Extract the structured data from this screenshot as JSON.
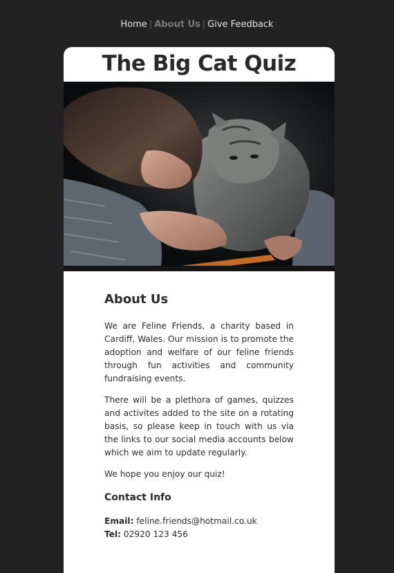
{
  "nav": {
    "items": [
      "Home",
      "About Us",
      "Give Feedback"
    ],
    "separator": "|",
    "active": "About Us"
  },
  "header": {
    "title": "The Big Cat Quiz"
  },
  "hero": {
    "subject": "girl-with-tabby-cat-photo"
  },
  "about": {
    "heading": "About Us",
    "paragraphs": [
      "We are Feline Friends, a charity based in Cardiff, Wales. Our mission is to promote the adoption and welfare of our feline friends through fun activities and community fundraising events.",
      "There will be a plethora of games, quizzes and activites added to the site on a rotating basis, so please keep in touch with us via the links to our social media accounts below which we aim to update regularly.",
      "We hope you enjoy our quiz!"
    ]
  },
  "contact": {
    "heading": "Contact Info",
    "email_label": "Email:",
    "email": "feline.friends@hotmail.co.uk",
    "tel_label": "Tel:",
    "tel": "02920 123 456"
  },
  "colors": {
    "background": "#222222",
    "card": "#ffffff",
    "text": "#2b2b2b",
    "nav_text": "#e6e6e6",
    "nav_active": "#7a7a7a"
  }
}
